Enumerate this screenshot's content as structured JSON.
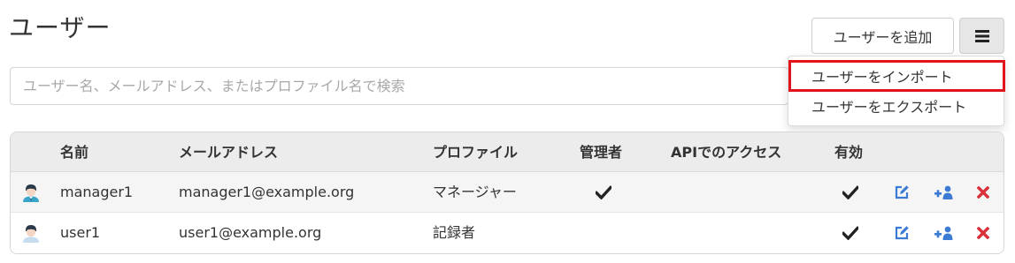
{
  "header": {
    "title": "ユーザー",
    "add_button_label": "ユーザーを追加",
    "menu_icon": "hamburger-icon"
  },
  "search": {
    "placeholder": "ユーザー名、メールアドレス、またはプロファイル名で検索",
    "value": ""
  },
  "menu_dropdown": {
    "items": [
      {
        "label": "ユーザーをインポート",
        "highlighted": true
      },
      {
        "label": "ユーザーをエクスポート",
        "highlighted": false
      }
    ]
  },
  "table": {
    "columns": [
      "名前",
      "メールアドレス",
      "プロファイル",
      "管理者",
      "APIでのアクセス",
      "有効"
    ],
    "rows": [
      {
        "avatar": "user-manager-avatar-icon",
        "name": "manager1",
        "email": "manager1@example.org",
        "profile": "マネージャー",
        "admin": true,
        "api_access": false,
        "enabled": true
      },
      {
        "avatar": "user-avatar-icon",
        "name": "user1",
        "email": "user1@example.org",
        "profile": "記録者",
        "admin": false,
        "api_access": false,
        "enabled": true
      }
    ],
    "row_actions": [
      "edit-icon",
      "add-group-icon",
      "delete-icon"
    ]
  },
  "colors": {
    "highlight_border": "#e1141e",
    "action_blue": "#3b7bd4",
    "delete_red": "#d9303a",
    "header_bg": "#ececec"
  }
}
